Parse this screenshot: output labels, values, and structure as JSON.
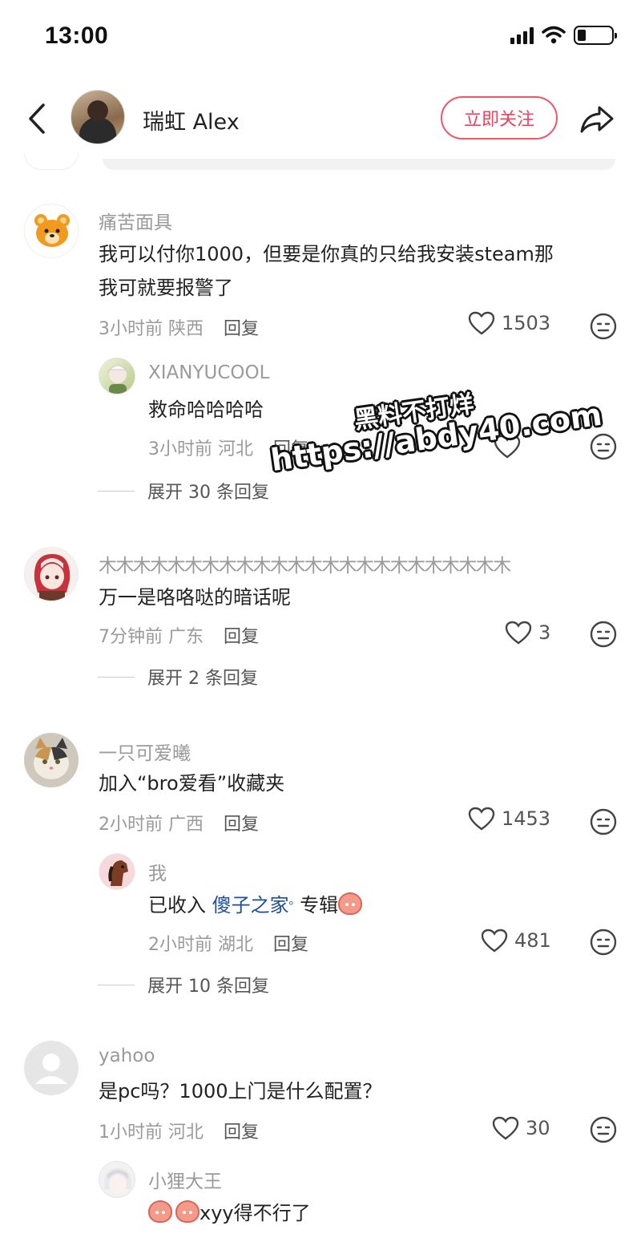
{
  "status_bar": {
    "time": "13:00"
  },
  "header": {
    "author_name": "瑞虹 Alex",
    "follow_label": "立即关注"
  },
  "comments": [
    {
      "username": "痛苦面具",
      "text_line1": "我可以付你1000，但要是你真的只给我安装steam那",
      "text_line2": "我可就要报警了",
      "time": "3小时前",
      "location": "陕西",
      "reply_label": "回复",
      "likes": "1503",
      "avatar_icon": "bear-avatar-icon",
      "replies": [
        {
          "username": "XIANYUCOOL",
          "text": "救命哈哈哈哈",
          "time": "3小时前",
          "location": "河北",
          "reply_label": "回复"
        }
      ],
      "expand_label": "展开 30 条回复"
    },
    {
      "username": "木木木木木木木木木木木木木木木木木木木木木木木木",
      "text": "万一是咯咯哒的暗话呢",
      "time": "7分钟前",
      "location": "广东",
      "reply_label": "回复",
      "likes": "3",
      "expand_label": "展开 2 条回复"
    },
    {
      "username": "一只可爱曦",
      "text": "加入“bro爱看”收藏夹",
      "time": "2小时前",
      "location": "广西",
      "reply_label": "回复",
      "likes": "1453",
      "replies": [
        {
          "username": "我",
          "text_prefix": "已收入",
          "link_text": "傻子之家",
          "text_suffix": "专辑",
          "time": "2小时前",
          "location": "湖北",
          "reply_label": "回复",
          "likes": "481"
        }
      ],
      "expand_label": "展开 10 条回复"
    },
    {
      "username": "yahoo",
      "text": "是pc吗？1000上门是什么配置？",
      "time": "1小时前",
      "location": "河北",
      "reply_label": "回复",
      "likes": "30",
      "replies": [
        {
          "username": "小狸大王",
          "text": "xyy得不行了"
        }
      ]
    }
  ],
  "watermark": {
    "line1": "黑料不打烊",
    "line2": "https://abdy40.com"
  },
  "colors": {
    "accent": "#f0405a",
    "link": "#1e4f9e",
    "muted": "#9a9a9a"
  }
}
